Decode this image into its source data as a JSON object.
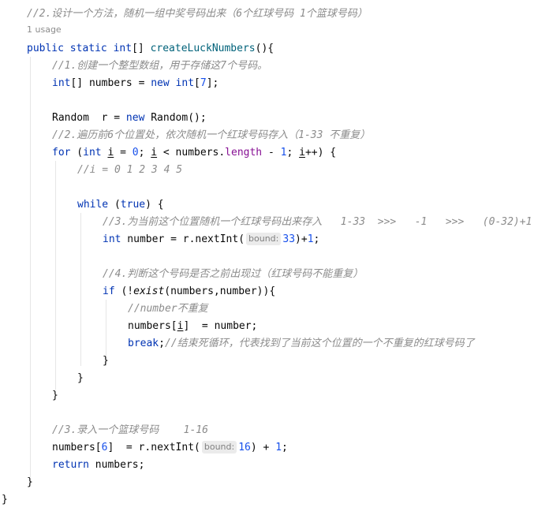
{
  "comments": {
    "c0": "//2.设计一个方法，随机一组中奖号码出来（6个红球号码 1个篮球号码）",
    "c1": "//1.创建一个整型数组，用于存储这7个号码。",
    "c2": "//2.遍历前6个位置处，依次随机一个红球号码存入（1-33 不重复）",
    "c3": "//i = 0 1 2 3 4 5",
    "c4": "//3.为当前这个位置随机一个红球号码出来存入   1-33  >>>   -1   >>>   (0-32)+1",
    "c5": "//4.判断这个号码是否之前出现过（红球号码不能重复）",
    "c6": "//number不重复",
    "c7": "//结束死循环，代表找到了当前这个位置的一个不重复的红球号码了",
    "c8": "//3.录入一个篮球号码    1-16"
  },
  "usage": "1 usage",
  "hints": {
    "bound1": "bound:",
    "bound2": "bound:"
  },
  "code": {
    "public": "public",
    "static": "static",
    "int": "int",
    "brackets": "[] ",
    "method": "createLuckNumbers",
    "method_tail": "(){",
    "numbers_decl": "[] numbers = ",
    "new": "new",
    "int_array": "int",
    "array_len": "7",
    "array_end": "];",
    "random_decl": "Random  r = ",
    "new2": "new",
    "random_ctor": " Random();",
    "for": "for",
    "for_open": " (",
    "for_int": "int",
    "for_i": "i",
    "for_eq": " = ",
    "for_zero": "0",
    "for_semi": "; ",
    "for_i2": "i",
    "for_lt": " < numbers.",
    "length": "length",
    "for_minus": " - ",
    "for_one": "1",
    "for_semi2": "; ",
    "for_i3": "i",
    "for_end": "++) {",
    "while": "while",
    "while_open": " (",
    "true": "true",
    "while_end": ") {",
    "int2": "int",
    "number_decl": " number = r.nextInt(",
    "bound33": "33",
    "number_end": ")+",
    "one1": "1",
    "semi1": ";",
    "if": "if",
    "if_open": " (!",
    "exist": "exist",
    "if_args": "(numbers,number)){",
    "assign_pre": "numbers[",
    "assign_i": "i",
    "assign_post": "]  = number;",
    "break": "break",
    "break_semi": ";",
    "close_if": "}",
    "close_while": "}",
    "close_for": "}",
    "blue_pre": "numbers[",
    "blue_idx": "6",
    "blue_mid": "]  = r.nextInt(",
    "bound16": "16",
    "blue_plus": ") + ",
    "one2": "1",
    "semi2": ";",
    "return": "return",
    "return_val": " numbers;",
    "close_method": "}",
    "close_class": "}"
  }
}
